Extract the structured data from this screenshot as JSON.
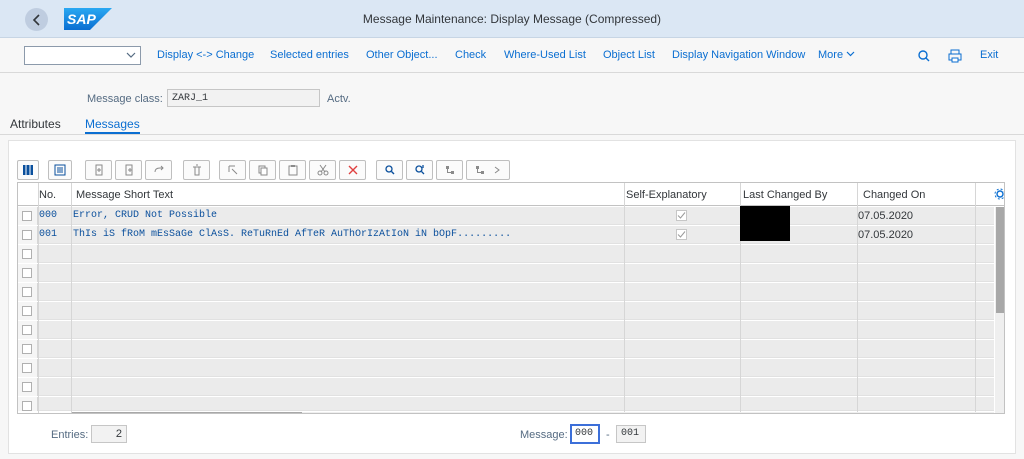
{
  "shell": {
    "title": "Message Maintenance: Display Message (Compressed)",
    "logo_text": "SAP"
  },
  "toolbar": {
    "select_value": "",
    "items": [
      "Display <-> Change",
      "Selected entries",
      "Other Object...",
      "Check",
      "Where-Used List",
      "Object List",
      "Display Navigation Window",
      "More"
    ],
    "exit_label": "Exit"
  },
  "header": {
    "message_class_label": "Message class:",
    "message_class_value": "ZARJ_1",
    "status": "Actv."
  },
  "tabs": {
    "attributes": "Attributes",
    "messages": "Messages"
  },
  "table": {
    "columns": {
      "no": "No.",
      "short_text": "Message Short Text",
      "self_explanatory": "Self-Explanatory",
      "last_changed_by": "Last Changed By",
      "changed_on": "Changed On"
    },
    "rows": [
      {
        "no": "000",
        "text": "Error, CRUD Not Possible",
        "self_explanatory": true,
        "changed_on": "07.05.2020"
      },
      {
        "no": "001",
        "text": "ThIs iS fRoM mEsSaGe ClAsS. ReTuRnEd AfTeR AuThOrIzAtIoN iN bOpF.........",
        "self_explanatory": true,
        "changed_on": "07.05.2020"
      }
    ]
  },
  "footer": {
    "entries_label": "Entries:",
    "entries_value": "2",
    "message_label": "Message:",
    "message_from": "000",
    "range_dash": "-",
    "message_to": "001"
  },
  "colors": {
    "accent": "#0a6ed1",
    "shell_bg": "#dbe7f4"
  }
}
